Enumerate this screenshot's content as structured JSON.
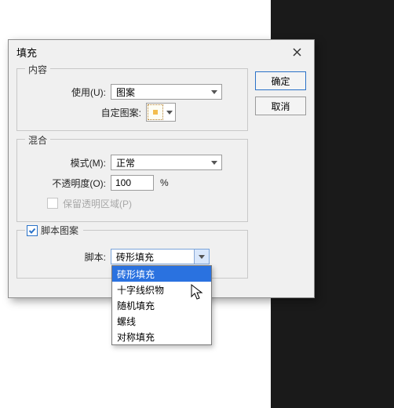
{
  "window": {
    "title": "填充",
    "close_icon": "close-icon"
  },
  "buttons": {
    "ok": "确定",
    "cancel": "取消"
  },
  "content_group": {
    "legend": "内容",
    "use_label": "使用(U):",
    "use_value": "图案",
    "custom_pattern_label": "自定图案:"
  },
  "blend_group": {
    "legend": "混合",
    "mode_label": "模式(M):",
    "mode_value": "正常",
    "opacity_label": "不透明度(O):",
    "opacity_value": "100",
    "opacity_unit": "%",
    "preserve_trans_label": "保留透明区域(P)",
    "preserve_checked": false
  },
  "script_group": {
    "checked": true,
    "legend": "脚本图案",
    "script_label": "脚本:",
    "script_value": "砖形填充",
    "options": [
      "砖形填充",
      "十字线织物",
      "随机填充",
      "螺线",
      "对称填充"
    ],
    "selected_index": 0
  }
}
